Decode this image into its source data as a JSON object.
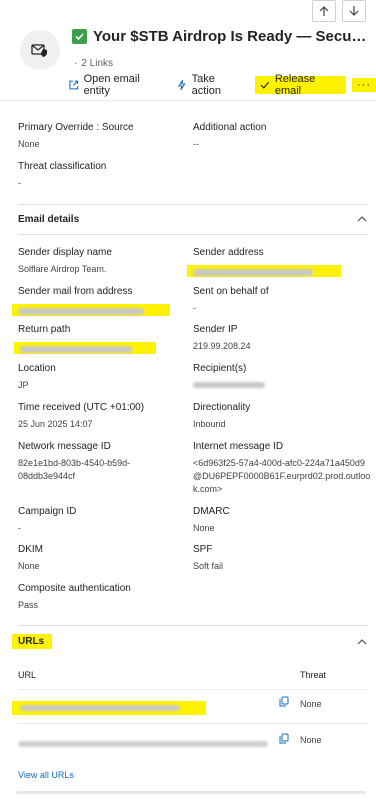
{
  "header": {
    "title": "Your $STB Airdrop Is Ready — Secur...",
    "links_count": "2 Links",
    "actions": [
      {
        "label": "Open email entity",
        "icon": "open-external-icon"
      },
      {
        "label": "Take action",
        "icon": "lightning-icon"
      },
      {
        "label": "Release email",
        "icon": "checkmark-icon"
      }
    ],
    "more": "···"
  },
  "top_fields": {
    "primary_override_label": "Primary Override : Source",
    "primary_override_value": "None",
    "additional_action_label": "Additional action",
    "additional_action_value": "--",
    "threat_classification_label": "Threat classification",
    "threat_classification_value": "-"
  },
  "email_details": {
    "title": "Email details",
    "sender_display_name_label": "Sender display name",
    "sender_display_name_value": "Solflare Airdrop Team.",
    "sender_address_label": "Sender address",
    "sender_mail_from_label": "Sender mail from address",
    "sent_on_behalf_label": "Sent on behalf of",
    "sent_on_behalf_value": "-",
    "return_path_label": "Return path",
    "sender_ip_label": "Sender IP",
    "sender_ip_value": "219.99.208.24",
    "location_label": "Location",
    "location_value": "JP",
    "recipients_label": "Recipient(s)",
    "time_received_label": "Time received (UTC +01:00)",
    "time_received_value": "25 Jun 2025 14:07",
    "directionality_label": "Directionality",
    "directionality_value": "Inbound",
    "network_message_id_label": "Network message ID",
    "network_message_id_value": "82e1e1bd-803b-4540-b59d-08ddb3e944cf",
    "internet_message_id_label": "Internet message ID",
    "internet_message_id_value": "<6d963f25-57a4-400d-afc0-224a71a450d9@DU6PEPF0000B61F.eurprd02.prod.outlook.com>",
    "campaign_id_label": "Campaign ID",
    "campaign_id_value": "-",
    "dmarc_label": "DMARC",
    "dmarc_value": "None",
    "dkim_label": "DKIM",
    "dkim_value": "None",
    "spf_label": "SPF",
    "spf_value": "Soft fail",
    "composite_auth_label": "Composite authentication",
    "composite_auth_value": "Pass"
  },
  "urls": {
    "title": "URLs",
    "col_url": "URL",
    "col_threat": "Threat",
    "rows": [
      {
        "threat": "None"
      },
      {
        "threat": "None"
      }
    ],
    "view_all": "View all URLs"
  },
  "colors": {
    "highlight": "#fff200",
    "check_green": "#3ca04a",
    "link_blue": "#0f6cbd"
  }
}
